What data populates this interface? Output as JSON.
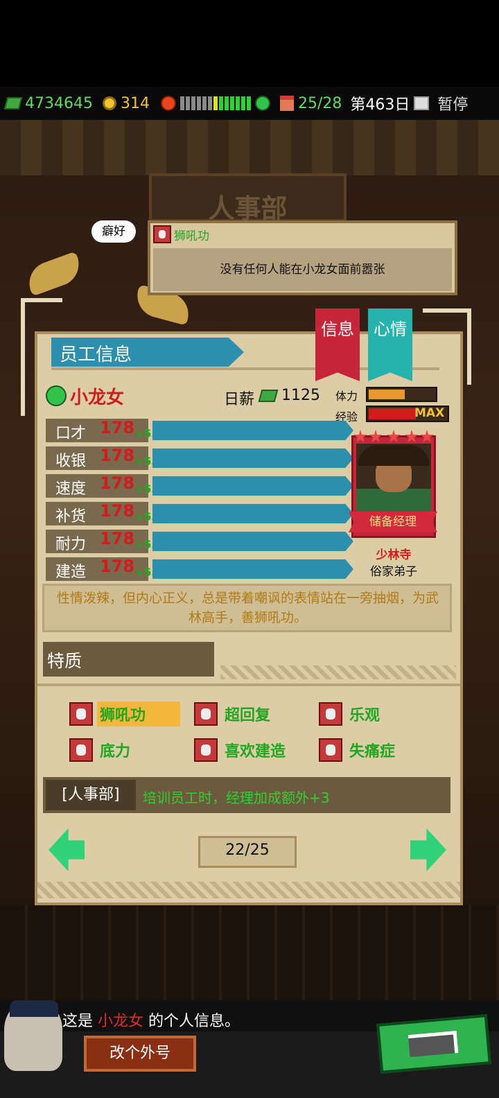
{
  "hud": {
    "money": "4734645",
    "coins": "314",
    "mood_segments": [
      "grey",
      "grey",
      "grey",
      "grey",
      "grey",
      "grey",
      "yellow",
      "green",
      "green",
      "green",
      "green",
      "green",
      "green"
    ],
    "staff": "25/28",
    "day": "第463日",
    "pause_label": "暂停"
  },
  "scene": {
    "sign": "人事部"
  },
  "hobby": {
    "tag": "癖好",
    "trait": "狮吼功",
    "description": "没有任何人能在小龙女面前嚣张"
  },
  "panel": {
    "title": "员工信息",
    "tabs": [
      {
        "label": "信息"
      },
      {
        "label": "心情"
      }
    ]
  },
  "employee": {
    "name": "小龙女",
    "salary_label": "日薪",
    "salary": "1125",
    "stamina_label": "体力",
    "stamina_fraction": 0.55,
    "exp_label": "经验",
    "exp_max": "MAX",
    "role": "储备经理",
    "school": "少林寺",
    "identity": "俗家弟子",
    "description": "性情泼辣，但内心正义，总是带着嘲讽的表情站在一旁抽烟，为武林高手，善狮吼功。"
  },
  "stats": [
    {
      "label": "口才",
      "value": "178",
      "bonus": "+53"
    },
    {
      "label": "收银",
      "value": "178",
      "bonus": "+53"
    },
    {
      "label": "速度",
      "value": "178",
      "bonus": "+53"
    },
    {
      "label": "补货",
      "value": "178",
      "bonus": "+53"
    },
    {
      "label": "耐力",
      "value": "178",
      "bonus": "+53"
    },
    {
      "label": "建造",
      "value": "178",
      "bonus": "+53"
    }
  ],
  "traits": {
    "title": "特质",
    "items": [
      {
        "label": "狮吼功"
      },
      {
        "label": "超回复"
      },
      {
        "label": "乐观"
      },
      {
        "label": "底力"
      },
      {
        "label": "喜欢建造"
      },
      {
        "label": "失痛症"
      }
    ]
  },
  "department": {
    "tag": "[人事部]",
    "effect": "培训员工时，经理加成额外+3"
  },
  "pagination": {
    "text": "22/25"
  },
  "footer": {
    "dialog_pre": "这是",
    "dialog_name": "小龙女",
    "dialog_post": "的个人信息。",
    "rename_label": "改个外号"
  },
  "colors": {
    "accent_blue": "#2c8fad",
    "accent_red": "#c7263a",
    "accent_teal": "#26b3ad",
    "stat_value": "#d11c1c",
    "bonus_green": "#1fa81f"
  }
}
